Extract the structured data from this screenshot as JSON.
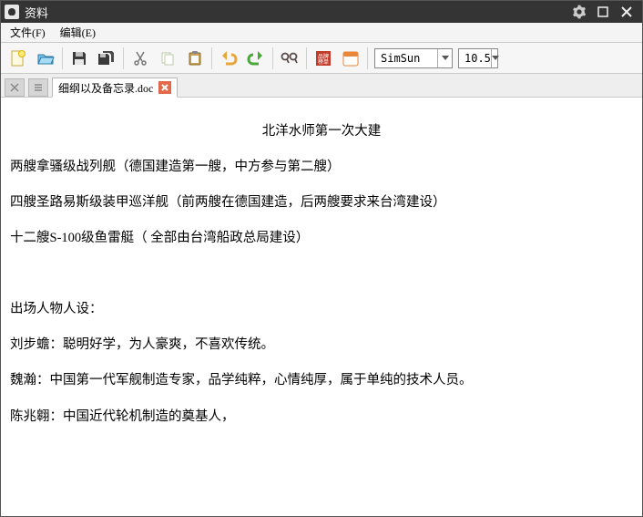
{
  "titlebar": {
    "title": "资料"
  },
  "menubar": {
    "file": "文件(F)",
    "edit": "编辑(E)"
  },
  "toolbar": {
    "font_name": "SimSun",
    "font_size": "10.5"
  },
  "tabbar": {
    "active_tab": "细纲以及备忘录.doc"
  },
  "document": {
    "title": "北洋水师第一次大建",
    "line1": "两艘拿骚级战列舰（德国建造第一艘，中方参与第二艘）",
    "line2": "四艘圣路易斯级装甲巡洋舰（前两艘在德国建造，后两艘要求来台湾建设）",
    "line3": "十二艘S-100级鱼雷艇（ 全部由台湾船政总局建设）",
    "blank": "",
    "line4": "出场人物人设：",
    "line5": "刘步蟾：聪明好学，为人豪爽，不喜欢传统。",
    "line6": "魏瀚：中国第一代军舰制造专家，品学纯粹，心情纯厚，属于单纯的技术人员。",
    "line7": "陈兆翱：中国近代轮机制造的奠基人，"
  }
}
